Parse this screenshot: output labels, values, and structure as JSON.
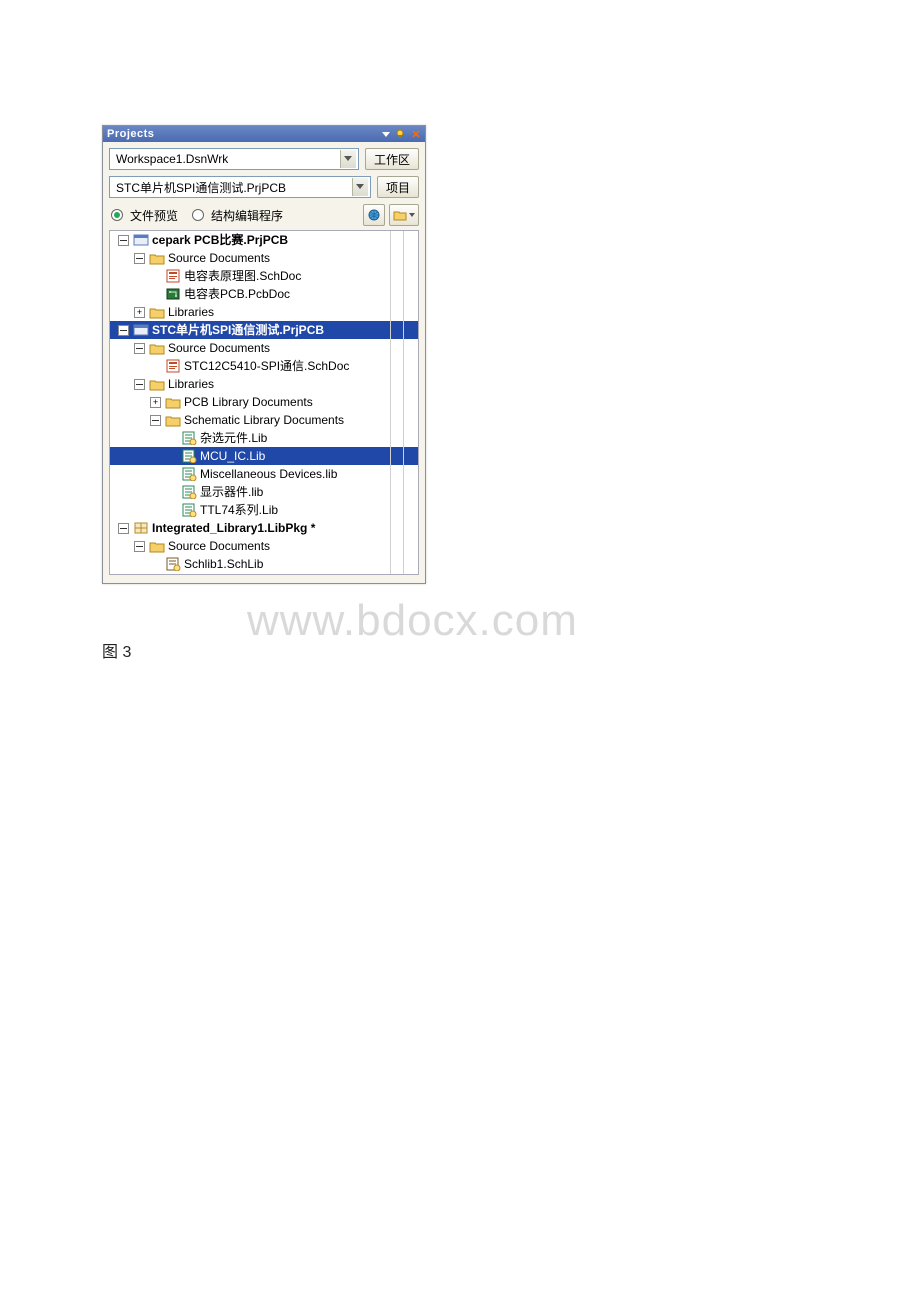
{
  "panel": {
    "title": "Projects",
    "workspace": {
      "value": "Workspace1.DsnWrk",
      "button": "工作区"
    },
    "project": {
      "value": "STC单片机SPI通信测试.PrjPCB",
      "button": "项目"
    },
    "radios": {
      "preview": "文件预览",
      "structure": "结构编辑程序"
    },
    "toolbar": {
      "left_icon": "globe-icon",
      "right_icon": "folder-icon"
    }
  },
  "tree": [
    {
      "depth": 0,
      "exp": "-",
      "icon": "prj",
      "label": "cepark PCB比赛.PrjPCB",
      "bold": true
    },
    {
      "depth": 1,
      "exp": "-",
      "icon": "folder",
      "label": "Source Documents"
    },
    {
      "depth": 2,
      "exp": "",
      "icon": "sch",
      "label": "电容表原理图.SchDoc"
    },
    {
      "depth": 2,
      "exp": "",
      "icon": "pcb",
      "label": "电容表PCB.PcbDoc"
    },
    {
      "depth": 1,
      "exp": "+",
      "icon": "folder",
      "label": "Libraries"
    },
    {
      "depth": 0,
      "exp": "-",
      "icon": "prj",
      "label": "STC单片机SPI通信测试.PrjPCB",
      "bold": true,
      "sel": true
    },
    {
      "depth": 1,
      "exp": "-",
      "icon": "folder",
      "label": "Source Documents"
    },
    {
      "depth": 2,
      "exp": "",
      "icon": "sch",
      "label": "STC12C5410-SPI通信.SchDoc"
    },
    {
      "depth": 1,
      "exp": "-",
      "icon": "folder",
      "label": "Libraries"
    },
    {
      "depth": 2,
      "exp": "+",
      "icon": "folder",
      "label": "PCB Library Documents"
    },
    {
      "depth": 2,
      "exp": "-",
      "icon": "folder",
      "label": "Schematic Library Documents"
    },
    {
      "depth": 3,
      "exp": "",
      "icon": "lib",
      "label": "杂选元件.Lib"
    },
    {
      "depth": 3,
      "exp": "",
      "icon": "lib",
      "label": "MCU_IC.Lib",
      "sel": true
    },
    {
      "depth": 3,
      "exp": "",
      "icon": "lib",
      "label": "Miscellaneous Devices.lib"
    },
    {
      "depth": 3,
      "exp": "",
      "icon": "lib",
      "label": "显示器件.lib"
    },
    {
      "depth": 3,
      "exp": "",
      "icon": "lib",
      "label": "TTL74系列.Lib"
    },
    {
      "depth": 0,
      "exp": "-",
      "icon": "pkg",
      "label": "Integrated_Library1.LibPkg *",
      "bold": true
    },
    {
      "depth": 1,
      "exp": "-",
      "icon": "folder",
      "label": "Source Documents"
    },
    {
      "depth": 2,
      "exp": "",
      "icon": "schlib",
      "label": "Schlib1.SchLib"
    }
  ],
  "caption": "图 3",
  "watermark": "www.bdocx.com"
}
